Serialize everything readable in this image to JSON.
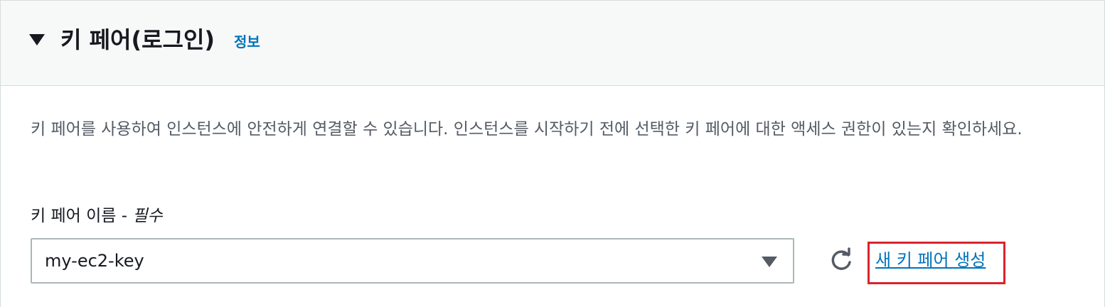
{
  "section": {
    "title": "키 페어(로그인)",
    "info_link": "정보",
    "description": "키 페어를 사용하여 인스턴스에 안전하게 연결할 수 있습니다. 인스턴스를 시작하기 전에 선택한 키 페어에 대한 액세스 권한이 있는지 확인하세요."
  },
  "field": {
    "label": "키 페어 이름 - ",
    "required": "필수",
    "selected_value": "my-ec2-key"
  },
  "actions": {
    "create_link": "새 키 페어 생성"
  },
  "icons": {
    "collapse": "caret-down-icon",
    "dropdown": "caret-down-icon",
    "refresh": "refresh-icon"
  },
  "colors": {
    "link": "#0073bb",
    "highlight": "#d9232e",
    "header_bg": "#f7f8f8"
  }
}
